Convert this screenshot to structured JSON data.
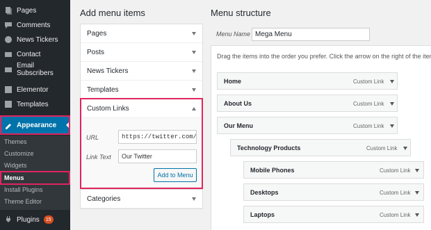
{
  "sidebar": {
    "items": [
      {
        "label": "Pages",
        "icon": "pages-icon"
      },
      {
        "label": "Comments",
        "icon": "comments-icon"
      },
      {
        "label": "News Tickers",
        "icon": "news-tickers-icon"
      },
      {
        "label": "Contact",
        "icon": "contact-icon"
      },
      {
        "label": "Email Subscribers",
        "icon": "email-icon"
      },
      {
        "label": "Elementor",
        "icon": "elementor-icon"
      },
      {
        "label": "Templates",
        "icon": "templates-icon"
      },
      {
        "label": "Appearance",
        "icon": "appearance-icon"
      }
    ],
    "sub": [
      "Themes",
      "Customize",
      "Widgets",
      "Menus",
      "Install Plugins",
      "Theme Editor"
    ],
    "plugins": {
      "label": "Plugins",
      "badge": "15"
    }
  },
  "add_items": {
    "title": "Add menu items",
    "sections": [
      "Pages",
      "Posts",
      "News Tickers",
      "Templates"
    ],
    "custom_links": {
      "title": "Custom Links",
      "url_label": "URL",
      "url_value": "https://twitter.com/Q",
      "link_text_label": "Link Text",
      "link_text_value": "Our Twitter",
      "button": "Add to Menu"
    },
    "categories": "Categories"
  },
  "structure": {
    "title": "Menu structure",
    "menu_name_label": "Menu Name",
    "menu_name_value": "Mega Menu",
    "hint": "Drag the items into the order you prefer. Click the arrow on the right of the item to re",
    "items": [
      {
        "label": "Home",
        "type": "Custom Link"
      },
      {
        "label": "About Us",
        "type": "Custom Link"
      },
      {
        "label": "Our Menu",
        "type": "Custom Link"
      },
      {
        "label": "Technology Products",
        "type": "Custom Link"
      },
      {
        "label": "Mobile Phones",
        "type": "Custom Link"
      },
      {
        "label": "Desktops",
        "type": "Custom Link"
      },
      {
        "label": "Laptops",
        "type": "Custom Link"
      }
    ]
  }
}
